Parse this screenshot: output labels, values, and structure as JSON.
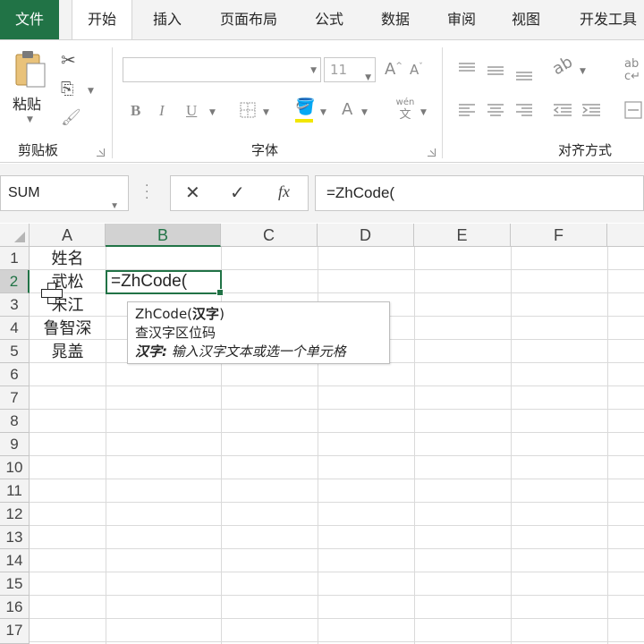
{
  "tabs": [
    "文件",
    "开始",
    "插入",
    "页面布局",
    "公式",
    "数据",
    "审阅",
    "视图",
    "开发工具"
  ],
  "ribbon": {
    "clipboard": {
      "paste_label": "粘贴",
      "group_label": "剪贴板"
    },
    "font": {
      "group_label": "字体",
      "font_name": "",
      "font_size": "11",
      "bold": "B",
      "italic": "I",
      "underline": "U",
      "font_color_letter": "A",
      "grow_font": "A",
      "shrink_font": "A",
      "phonetic_top": "wén",
      "phonetic_bottom": "文"
    },
    "alignment": {
      "group_label": "对齐方式",
      "wrap_glyph": "ab"
    }
  },
  "formula_bar": {
    "name_box": "SUM",
    "cancel": "✕",
    "enter": "✓",
    "fx": "fx",
    "content": "=ZhCode("
  },
  "columns": [
    "A",
    "B",
    "C",
    "D",
    "E",
    "F"
  ],
  "rows": [
    "1",
    "2",
    "3",
    "4",
    "5",
    "6",
    "7",
    "8",
    "9",
    "10",
    "11",
    "12",
    "13",
    "14",
    "15",
    "16",
    "17"
  ],
  "cells": {
    "A1": "姓名",
    "A2": "武松",
    "A3": "宋江",
    "A4": "鲁智深",
    "A5": "晁盖",
    "B2": "=ZhCode("
  },
  "tooltip": {
    "func_name": "ZhCode(",
    "arg": "汉字",
    "close_paren": ")",
    "description": "查汉字区位码",
    "arg_label": "汉字:",
    "arg_help": "输入汉字文本或选一个单元格"
  },
  "colors": {
    "accent": "#217346",
    "header_selected": "#d2d2d2"
  }
}
